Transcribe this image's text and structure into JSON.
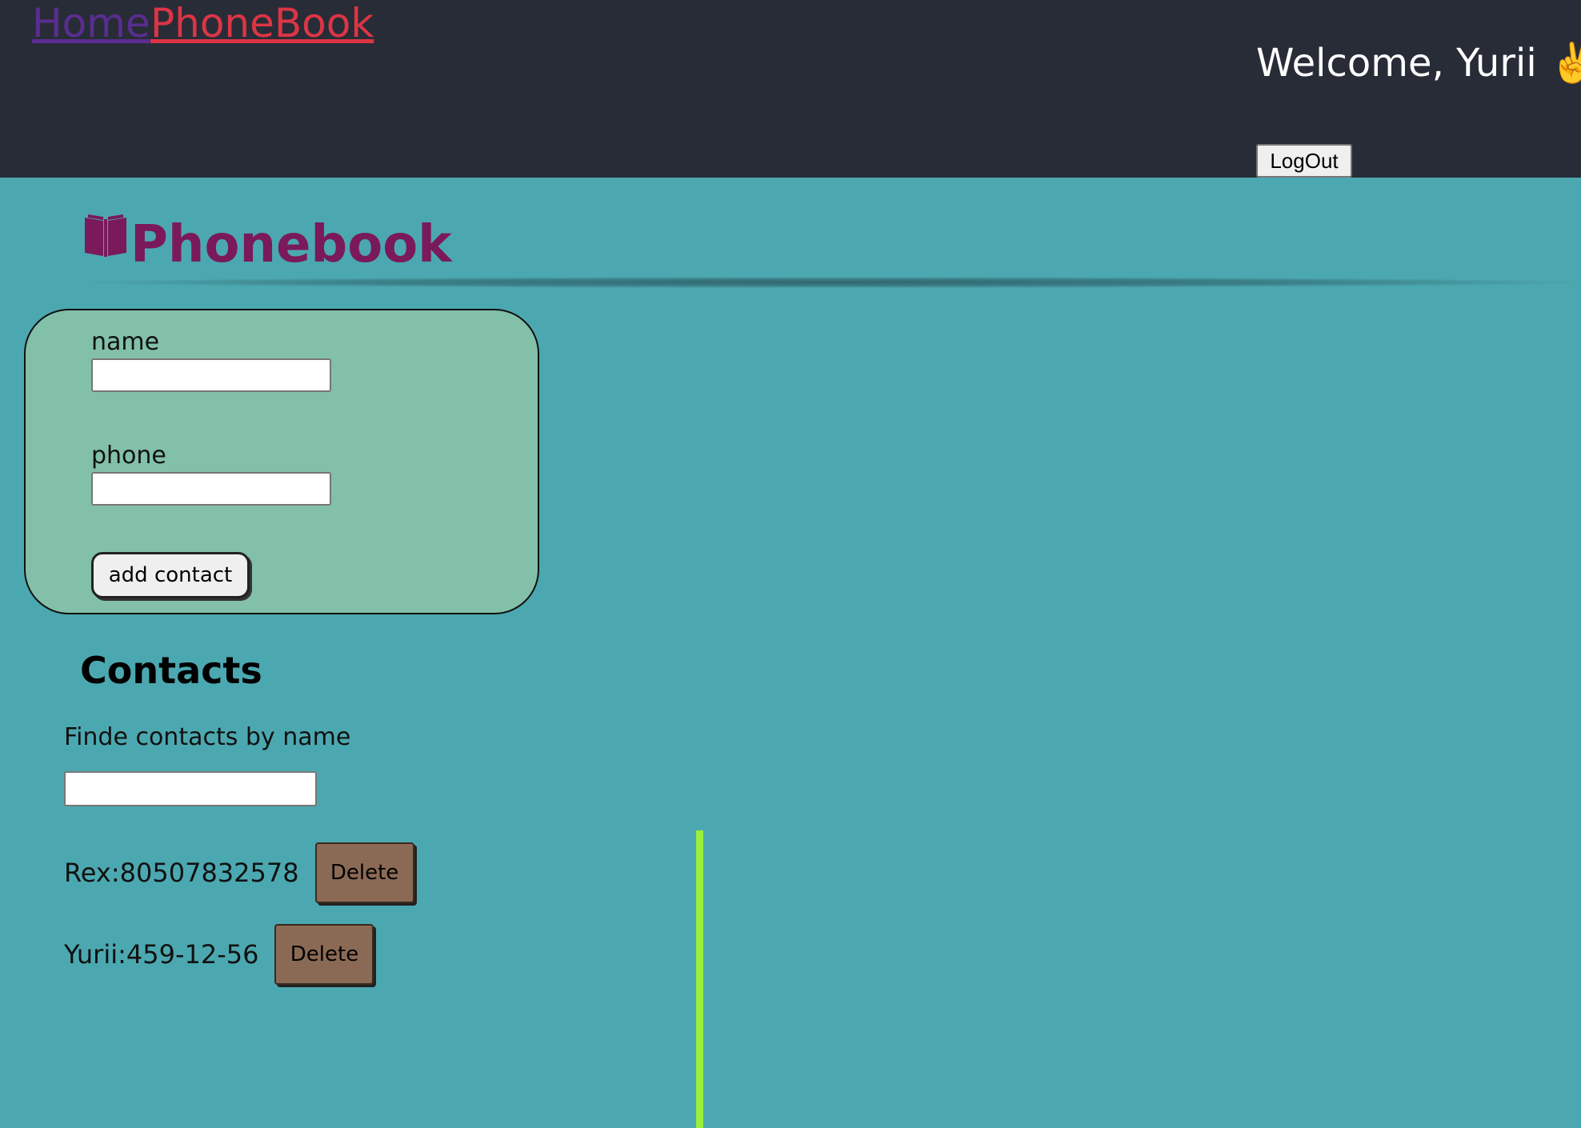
{
  "nav": {
    "home_label": "Home",
    "phonebook_label": "PhoneBook"
  },
  "user": {
    "welcome_text": "Welcome, Yurii",
    "welcome_emoji": "✌️",
    "logout_label": "LogOut"
  },
  "page": {
    "title": "Phonebook",
    "title_icon": "book-icon"
  },
  "form": {
    "name_label": "name",
    "name_value": "",
    "phone_label": "phone",
    "phone_value": "",
    "submit_label": "add contact"
  },
  "contacts": {
    "title": "Contacts",
    "filter_label": "Finde contacts by name",
    "filter_value": "",
    "items": [
      {
        "text": "Rex:80507832578",
        "delete_label": "Delete"
      },
      {
        "text": "Yurii:459-12-56",
        "delete_label": "Delete"
      }
    ]
  },
  "colors": {
    "header_bg": "#282c37",
    "page_bg": "#4ca8b0",
    "form_bg": "#82c0a9",
    "title_color": "#7a1a5a",
    "delete_bg": "#8b6a55",
    "accent_line": "#9aef3c"
  }
}
